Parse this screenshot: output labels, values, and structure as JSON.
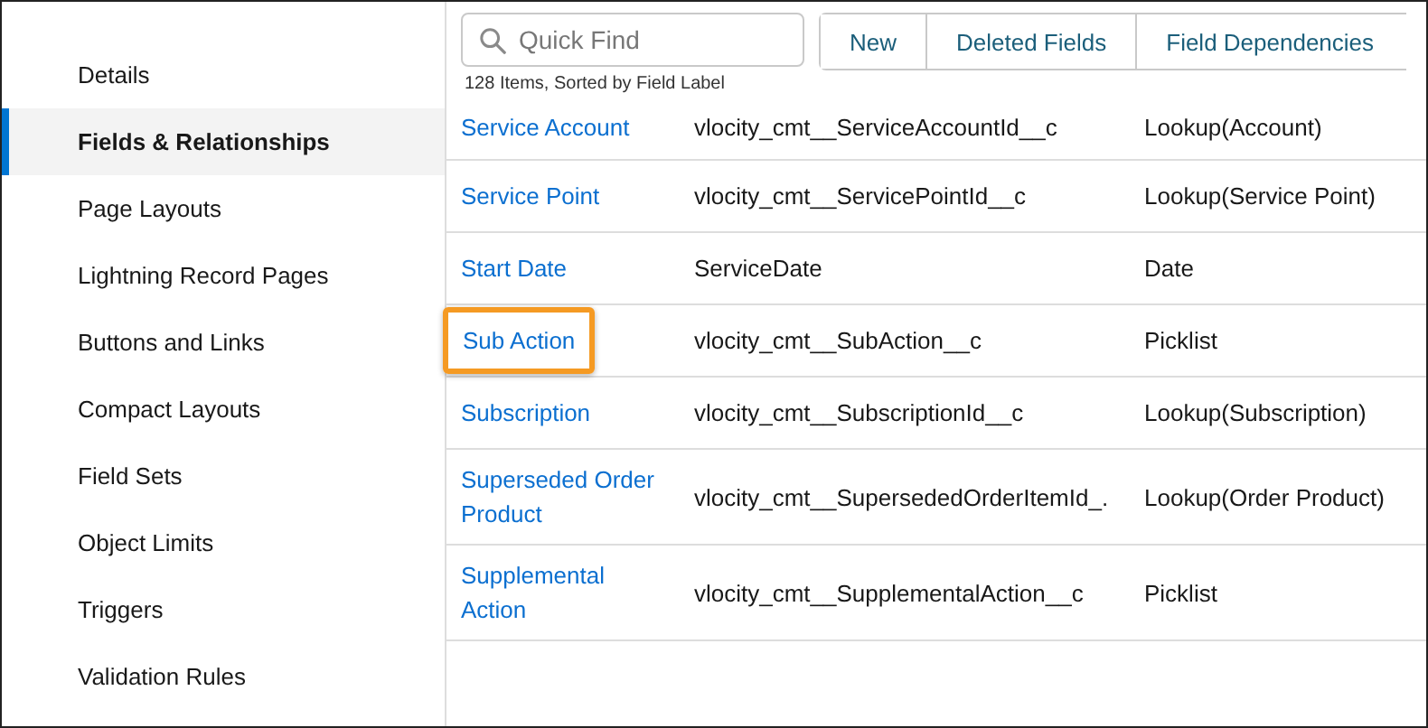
{
  "sidebar": {
    "items": [
      {
        "label": "Details",
        "selected": false
      },
      {
        "label": "Fields & Relationships",
        "selected": true
      },
      {
        "label": "Page Layouts",
        "selected": false
      },
      {
        "label": "Lightning Record Pages",
        "selected": false
      },
      {
        "label": "Buttons and Links",
        "selected": false
      },
      {
        "label": "Compact Layouts",
        "selected": false
      },
      {
        "label": "Field Sets",
        "selected": false
      },
      {
        "label": "Object Limits",
        "selected": false
      },
      {
        "label": "Triggers",
        "selected": false
      },
      {
        "label": "Validation Rules",
        "selected": false
      }
    ]
  },
  "search": {
    "placeholder": "Quick Find"
  },
  "buttons": [
    "New",
    "Deleted Fields",
    "Field Dependencies"
  ],
  "count_text": "128 Items, Sorted by Field Label",
  "table": {
    "rows": [
      {
        "label": "Service Account",
        "api_name": "vlocity_cmt__ServiceAccountId__c",
        "type": "Lookup(Account)",
        "highlighted": false
      },
      {
        "label": "Service Point",
        "api_name": "vlocity_cmt__ServicePointId__c",
        "type": "Lookup(Service Point)",
        "highlighted": false
      },
      {
        "label": "Start Date",
        "api_name": "ServiceDate",
        "type": "Date",
        "highlighted": false
      },
      {
        "label": "Sub Action",
        "api_name": "vlocity_cmt__SubAction__c",
        "type": "Picklist",
        "highlighted": true
      },
      {
        "label": "Subscription",
        "api_name": "vlocity_cmt__SubscriptionId__c",
        "type": "Lookup(Subscription)",
        "highlighted": false
      },
      {
        "label": "Superseded Order Product",
        "api_name": "vlocity_cmt__SupersededOrderItemId_.",
        "type": "Lookup(Order Product)",
        "highlighted": false
      },
      {
        "label": "Supplemental Action",
        "api_name": "vlocity_cmt__SupplementalAction__c",
        "type": "Picklist",
        "highlighted": false
      }
    ]
  }
}
